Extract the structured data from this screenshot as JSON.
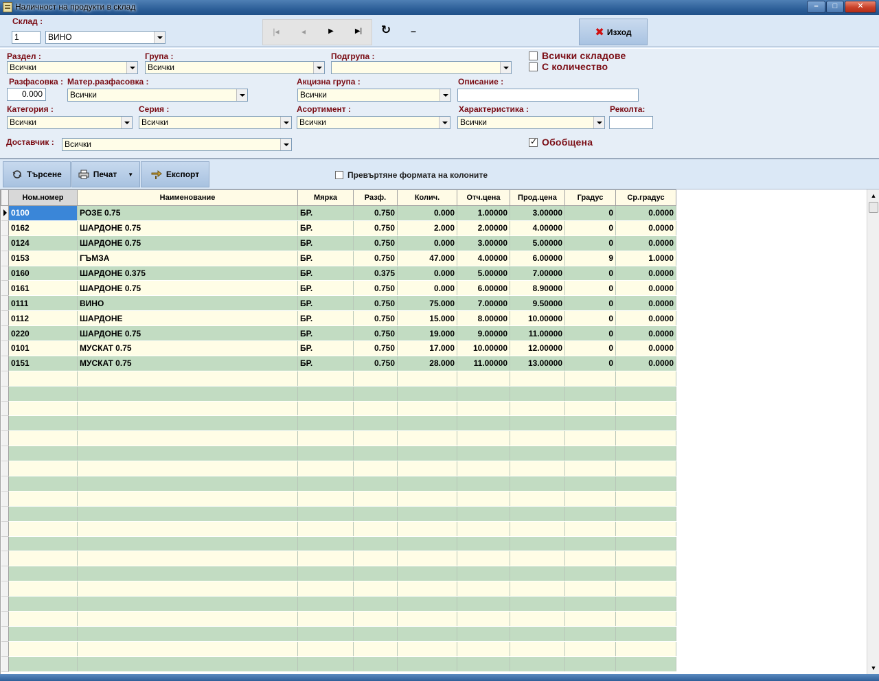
{
  "window": {
    "title": "Наличност на продукти в склад",
    "min": "–",
    "max": "□",
    "close": "✕"
  },
  "top": {
    "warehouse_label": "Склад :",
    "warehouse_no": "1",
    "warehouse_name": "ВИНО",
    "nav": {
      "first": "|◂",
      "prev": "◂",
      "next": "▶",
      "last": "▶|",
      "refresh": "↻",
      "minus": "–"
    },
    "exit_label": "Изход"
  },
  "filters": {
    "section_label": "Раздел :",
    "section_value": "Всички",
    "group_label": "Група :",
    "group_value": "Всички",
    "subgroup_label": "Подгрупа :",
    "subgroup_value": "",
    "all_warehouses_label": "Всички складове",
    "with_qty_label": "С количество",
    "packing_label": "Разфасовка :",
    "packing_value": "0.000",
    "mat_packing_label": "Матер.разфасовка :",
    "mat_packing_value": "Всички",
    "excise_label": "Акцизна група :",
    "excise_value": "Всички",
    "description_label": "Описание :",
    "description_value": "",
    "category_label": "Категория :",
    "category_value": "Всички",
    "series_label": "Серия :",
    "series_value": "Всички",
    "assortment_label": "Асортимент :",
    "assortment_value": "Всички",
    "characteristic_label": "Характеристика :",
    "characteristic_value": "Всички",
    "harvest_label": "Реколта:",
    "harvest_value": "",
    "supplier_label": "Доставчик :",
    "supplier_value": "Всички",
    "summarized_label": "Обобщена"
  },
  "toolbar": {
    "search_label": "Търсене",
    "print_label": "Печат",
    "export_label": "Експорт",
    "convert_label": "Превъртяне формата на колоните"
  },
  "table": {
    "columns": [
      "Ном.номер",
      "Наименование",
      "Мярка",
      "Разф.",
      "Колич.",
      "Отч.цена",
      "Прод.цена",
      "Градус",
      "Ср.градус"
    ],
    "rows": [
      [
        "0100",
        "РОЗЕ 0.75",
        "БР.",
        "0.750",
        "0.000",
        "1.00000",
        "3.00000",
        "0",
        "0.0000"
      ],
      [
        "0162",
        "ШАРДОНЕ 0.75",
        "БР.",
        "0.750",
        "2.000",
        "2.00000",
        "4.00000",
        "0",
        "0.0000"
      ],
      [
        "0124",
        "ШАРДОНЕ 0.75",
        "БР.",
        "0.750",
        "0.000",
        "3.00000",
        "5.00000",
        "0",
        "0.0000"
      ],
      [
        "0153",
        "ГЪМЗА",
        "БР.",
        "0.750",
        "47.000",
        "4.00000",
        "6.00000",
        "9",
        "1.0000"
      ],
      [
        "0160",
        "ШАРДОНЕ 0.375",
        "БР.",
        "0.375",
        "0.000",
        "5.00000",
        "7.00000",
        "0",
        "0.0000"
      ],
      [
        "0161",
        "ШАРДОНЕ 0.75",
        "БР.",
        "0.750",
        "0.000",
        "6.00000",
        "8.90000",
        "0",
        "0.0000"
      ],
      [
        "0111",
        "ВИНО",
        "БР.",
        "0.750",
        "75.000",
        "7.00000",
        "9.50000",
        "0",
        "0.0000"
      ],
      [
        "0112",
        "ШАРДОНЕ",
        "БР.",
        "0.750",
        "15.000",
        "8.00000",
        "10.00000",
        "0",
        "0.0000"
      ],
      [
        "0220",
        "ШАРДОНЕ 0.75",
        "БР.",
        "0.750",
        "19.000",
        "9.00000",
        "11.00000",
        "0",
        "0.0000"
      ],
      [
        "0101",
        "МУСКАТ 0.75",
        "БР.",
        "0.750",
        "17.000",
        "10.00000",
        "12.00000",
        "0",
        "0.0000"
      ],
      [
        "0151",
        "МУСКАТ 0.75",
        "БР.",
        "0.750",
        "28.000",
        "11.00000",
        "13.00000",
        "0",
        "0.0000"
      ]
    ]
  }
}
